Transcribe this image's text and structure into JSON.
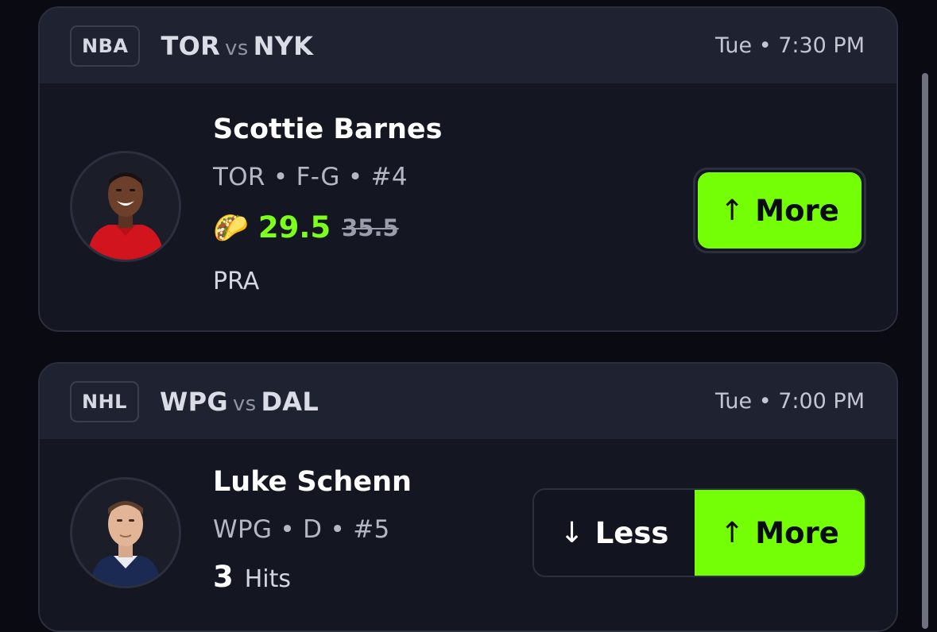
{
  "cards": [
    {
      "league": "NBA",
      "team_a": "TOR",
      "vs": "vs",
      "team_b": "NYK",
      "time": "Tue • 7:30 PM",
      "player": {
        "name": "Scottie Barnes",
        "meta": "TOR • F-G • #4",
        "promo_emoji": "🌮",
        "line_promo": "29.5",
        "line_original": "35.5",
        "stat": "PRA"
      },
      "more_label": "More"
    },
    {
      "league": "NHL",
      "team_a": "WPG",
      "vs": "vs",
      "team_b": "DAL",
      "time": "Tue • 7:00 PM",
      "player": {
        "name": "Luke Schenn",
        "meta": "WPG • D • #5",
        "line": "3",
        "stat": "Hits"
      },
      "less_label": "Less",
      "more_label": "More"
    }
  ],
  "colors": {
    "accent_green": "#75ff06",
    "promo_text": "#7cff1a",
    "background": "#090a12",
    "card": "#141622"
  }
}
